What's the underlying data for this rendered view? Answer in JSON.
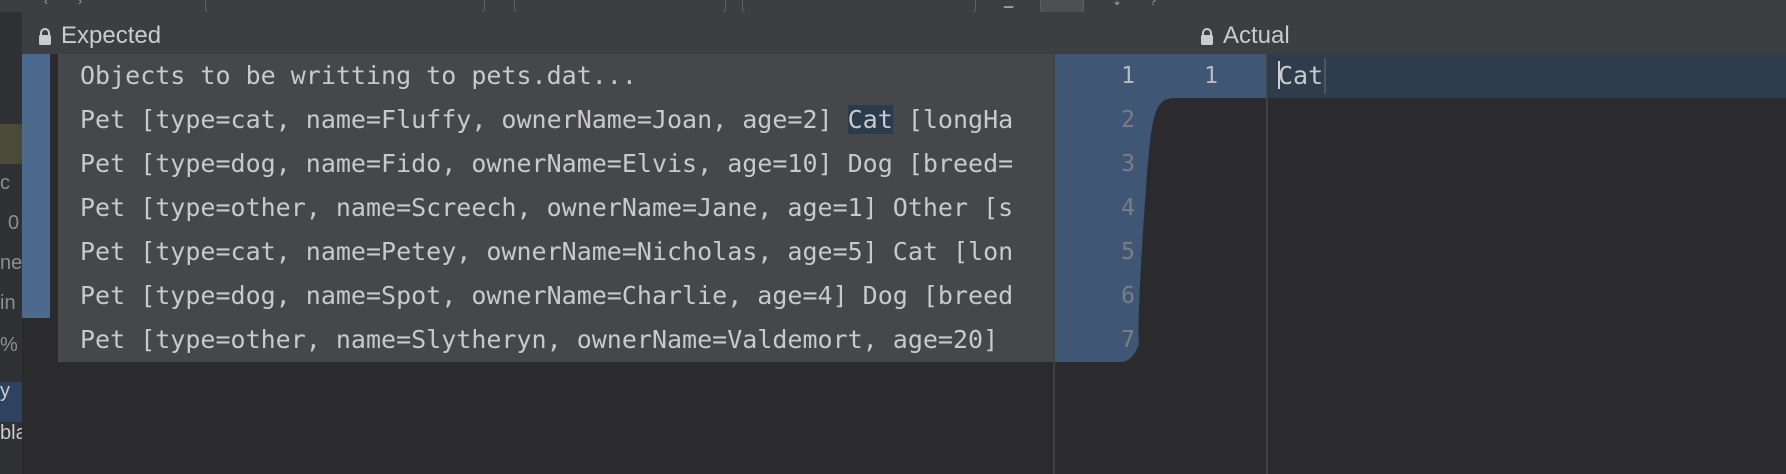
{
  "left_panel": {
    "title": "Expected",
    "lines": [
      "Objects to be writting to pets.dat...",
      "Pet [type=cat, name=Fluffy, ownerName=Joan, age=2] ",
      "Pet [type=dog, name=Fido, ownerName=Elvis, age=10] Dog [breed=",
      "Pet [type=other, name=Screech, ownerName=Jane, age=1] Other [s",
      "Pet [type=cat, name=Petey, ownerName=Nicholas, age=5] Cat [lon",
      "Pet [type=dog, name=Spot, ownerName=Charlie, age=4] Dog [breed",
      "Pet [type=other, name=Slytheryn, ownerName=Valdemort, age=20]"
    ],
    "line2_highlight": "Cat",
    "line2_suffix": " [longHa"
  },
  "right_panel": {
    "title": "Actual",
    "lines": [
      "Cat"
    ]
  },
  "gutter": {
    "left_numbers": [
      "1",
      "2",
      "3",
      "4",
      "5",
      "6",
      "7"
    ],
    "right_numbers": [
      "1"
    ]
  },
  "left_strip_fragments": [
    "c",
    "0",
    "ne",
    "in",
    "% I",
    "y",
    "bla"
  ],
  "colors": {
    "changed_block": "#4b6a8e",
    "modified_background": "#464749",
    "caret_line": "#2f3c4c"
  }
}
